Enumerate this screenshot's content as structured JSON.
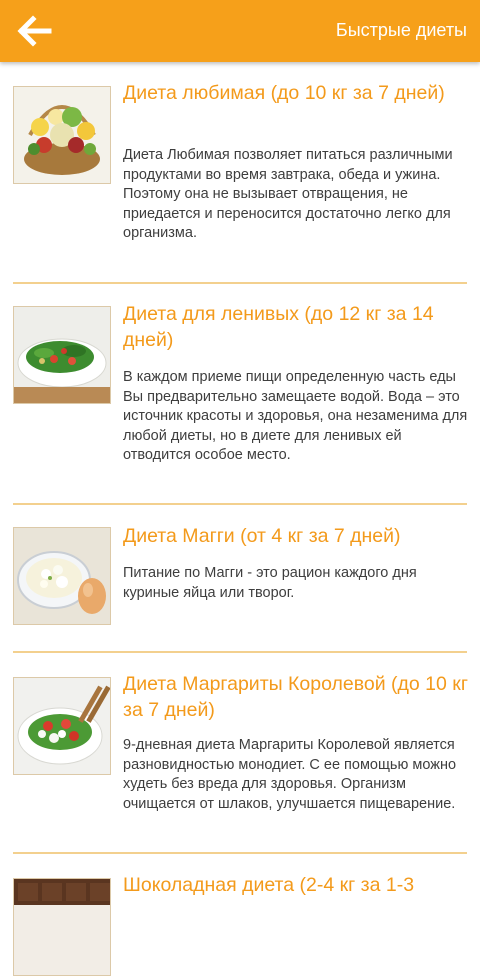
{
  "toolbar": {
    "back_icon": "arrow-left-icon",
    "title": "Быстрые диеты",
    "color": "#f6a01a"
  },
  "diets": [
    {
      "title": "Диета любимая (до 10 кг за 7 дней)",
      "description": "Диета Любимая позволяет питаться различными продуктами во время завтрака, обеда и ужина. Поэтому она не вызывает отвращения, не приедается и переносится достаточно легко для организма.",
      "image": "fruit-basket-image"
    },
    {
      "title": "Диета для ленивых (до 12 кг за 14 дней)",
      "description": "В каждом приеме пищи определенную часть еды Вы предварительно замещаете водой. Вода – это источник красоты и здоровья, она незаменима для любой диеты, но в диете для ленивых ей отводится особое место.",
      "image": "salad-plate-image"
    },
    {
      "title": "Диета Магги (от 4 кг за 7 дней)",
      "description": "Питание по Магги - это рацион каждого дня куриные яйца или творог.",
      "image": "cottage-cheese-egg-image"
    },
    {
      "title": "Диета Маргариты Королевой (до 10 кг за 7 дней)",
      "description": "9-дневная диета Маргариты Королевой является разновидностью монодиет. С ее помощью можно худеть без вреда для здоровья. Организм очищается от шлаков, улучшается пищеварение.",
      "image": "caprese-salad-image"
    },
    {
      "title": "Шоколадная диета (2-4 кг за 1-3",
      "description": "",
      "image": "chocolate-bar-image"
    }
  ]
}
